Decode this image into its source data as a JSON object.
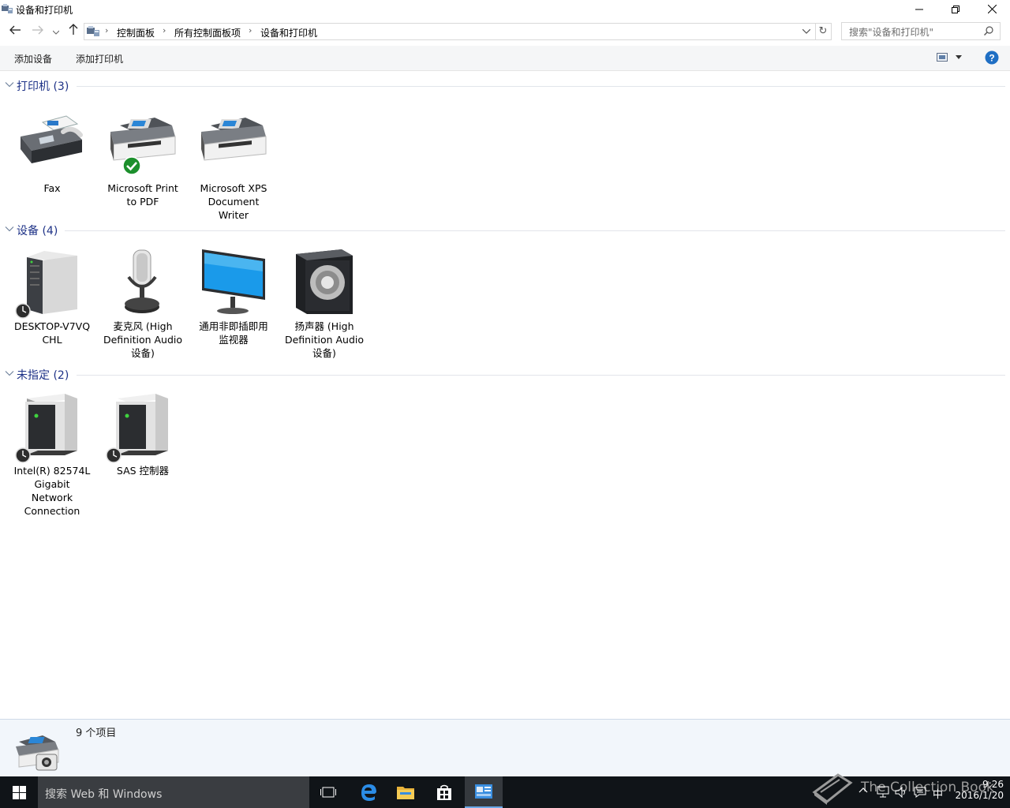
{
  "window": {
    "title": "设备和打印机"
  },
  "address": {
    "crumbs": [
      "控制面板",
      "所有控制面板项",
      "设备和打印机"
    ],
    "search_placeholder": "搜索\"设备和打印机\""
  },
  "commands": {
    "add_device": "添加设备",
    "add_printer": "添加打印机"
  },
  "groups": [
    {
      "label": "打印机 (3)",
      "items": [
        {
          "name": "Fax",
          "line1": "Fax",
          "line2": "",
          "line3": ""
        },
        {
          "name": "Microsoft Print to PDF",
          "line1": "Microsoft Print",
          "line2": "to PDF",
          "line3": "",
          "default": true
        },
        {
          "name": "Microsoft XPS Document Writer",
          "line1": "Microsoft XPS",
          "line2": "Document",
          "line3": "Writer"
        }
      ]
    },
    {
      "label": "设备 (4)",
      "items": [
        {
          "name": "DESKTOP-V7VQCHL",
          "line1": "DESKTOP-V7VQ",
          "line2": "CHL",
          "line3": ""
        },
        {
          "name": "麦克风 (High Definition Audio 设备)",
          "line1": "麦克风 (High",
          "line2": "Definition Audio",
          "line3": "设备)"
        },
        {
          "name": "通用非即插即用监视器",
          "line1": "通用非即插即用",
          "line2": "监视器",
          "line3": ""
        },
        {
          "name": "扬声器 (High Definition Audio 设备)",
          "line1": "扬声器 (High",
          "line2": "Definition Audio",
          "line3": "设备)"
        }
      ]
    },
    {
      "label": "未指定 (2)",
      "items": [
        {
          "name": "Intel(R) 82574L Gigabit Network Connection",
          "line1": "Intel(R) 82574L",
          "line2": "Gigabit",
          "line3": "Network",
          "line4": "Connection"
        },
        {
          "name": "SAS 控制器",
          "line1": "SAS 控制器",
          "line2": "",
          "line3": ""
        }
      ]
    }
  ],
  "details": {
    "count": "9 个项目"
  },
  "taskbar": {
    "search_placeholder": "搜索 Web 和 Windows",
    "ime": "中",
    "time": "9:26",
    "date": "2016/1/20",
    "watermark": "The Collection Book"
  },
  "colors": {
    "accent": "#1e3287",
    "taskbar": "#101418",
    "help": "#1f6fc4"
  }
}
